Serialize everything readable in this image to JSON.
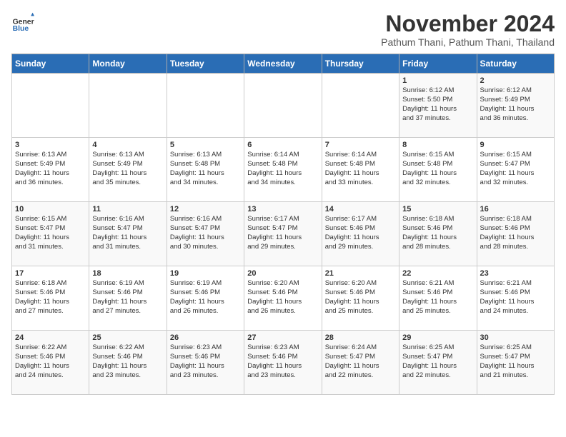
{
  "header": {
    "logo_general": "General",
    "logo_blue": "Blue",
    "month_title": "November 2024",
    "location": "Pathum Thani, Pathum Thani, Thailand"
  },
  "days_of_week": [
    "Sunday",
    "Monday",
    "Tuesday",
    "Wednesday",
    "Thursday",
    "Friday",
    "Saturday"
  ],
  "weeks": [
    [
      {
        "day": "",
        "info": ""
      },
      {
        "day": "",
        "info": ""
      },
      {
        "day": "",
        "info": ""
      },
      {
        "day": "",
        "info": ""
      },
      {
        "day": "",
        "info": ""
      },
      {
        "day": "1",
        "info": "Sunrise: 6:12 AM\nSunset: 5:50 PM\nDaylight: 11 hours\nand 37 minutes."
      },
      {
        "day": "2",
        "info": "Sunrise: 6:12 AM\nSunset: 5:49 PM\nDaylight: 11 hours\nand 36 minutes."
      }
    ],
    [
      {
        "day": "3",
        "info": "Sunrise: 6:13 AM\nSunset: 5:49 PM\nDaylight: 11 hours\nand 36 minutes."
      },
      {
        "day": "4",
        "info": "Sunrise: 6:13 AM\nSunset: 5:49 PM\nDaylight: 11 hours\nand 35 minutes."
      },
      {
        "day": "5",
        "info": "Sunrise: 6:13 AM\nSunset: 5:48 PM\nDaylight: 11 hours\nand 34 minutes."
      },
      {
        "day": "6",
        "info": "Sunrise: 6:14 AM\nSunset: 5:48 PM\nDaylight: 11 hours\nand 34 minutes."
      },
      {
        "day": "7",
        "info": "Sunrise: 6:14 AM\nSunset: 5:48 PM\nDaylight: 11 hours\nand 33 minutes."
      },
      {
        "day": "8",
        "info": "Sunrise: 6:15 AM\nSunset: 5:48 PM\nDaylight: 11 hours\nand 32 minutes."
      },
      {
        "day": "9",
        "info": "Sunrise: 6:15 AM\nSunset: 5:47 PM\nDaylight: 11 hours\nand 32 minutes."
      }
    ],
    [
      {
        "day": "10",
        "info": "Sunrise: 6:15 AM\nSunset: 5:47 PM\nDaylight: 11 hours\nand 31 minutes."
      },
      {
        "day": "11",
        "info": "Sunrise: 6:16 AM\nSunset: 5:47 PM\nDaylight: 11 hours\nand 31 minutes."
      },
      {
        "day": "12",
        "info": "Sunrise: 6:16 AM\nSunset: 5:47 PM\nDaylight: 11 hours\nand 30 minutes."
      },
      {
        "day": "13",
        "info": "Sunrise: 6:17 AM\nSunset: 5:47 PM\nDaylight: 11 hours\nand 29 minutes."
      },
      {
        "day": "14",
        "info": "Sunrise: 6:17 AM\nSunset: 5:46 PM\nDaylight: 11 hours\nand 29 minutes."
      },
      {
        "day": "15",
        "info": "Sunrise: 6:18 AM\nSunset: 5:46 PM\nDaylight: 11 hours\nand 28 minutes."
      },
      {
        "day": "16",
        "info": "Sunrise: 6:18 AM\nSunset: 5:46 PM\nDaylight: 11 hours\nand 28 minutes."
      }
    ],
    [
      {
        "day": "17",
        "info": "Sunrise: 6:18 AM\nSunset: 5:46 PM\nDaylight: 11 hours\nand 27 minutes."
      },
      {
        "day": "18",
        "info": "Sunrise: 6:19 AM\nSunset: 5:46 PM\nDaylight: 11 hours\nand 27 minutes."
      },
      {
        "day": "19",
        "info": "Sunrise: 6:19 AM\nSunset: 5:46 PM\nDaylight: 11 hours\nand 26 minutes."
      },
      {
        "day": "20",
        "info": "Sunrise: 6:20 AM\nSunset: 5:46 PM\nDaylight: 11 hours\nand 26 minutes."
      },
      {
        "day": "21",
        "info": "Sunrise: 6:20 AM\nSunset: 5:46 PM\nDaylight: 11 hours\nand 25 minutes."
      },
      {
        "day": "22",
        "info": "Sunrise: 6:21 AM\nSunset: 5:46 PM\nDaylight: 11 hours\nand 25 minutes."
      },
      {
        "day": "23",
        "info": "Sunrise: 6:21 AM\nSunset: 5:46 PM\nDaylight: 11 hours\nand 24 minutes."
      }
    ],
    [
      {
        "day": "24",
        "info": "Sunrise: 6:22 AM\nSunset: 5:46 PM\nDaylight: 11 hours\nand 24 minutes."
      },
      {
        "day": "25",
        "info": "Sunrise: 6:22 AM\nSunset: 5:46 PM\nDaylight: 11 hours\nand 23 minutes."
      },
      {
        "day": "26",
        "info": "Sunrise: 6:23 AM\nSunset: 5:46 PM\nDaylight: 11 hours\nand 23 minutes."
      },
      {
        "day": "27",
        "info": "Sunrise: 6:23 AM\nSunset: 5:46 PM\nDaylight: 11 hours\nand 23 minutes."
      },
      {
        "day": "28",
        "info": "Sunrise: 6:24 AM\nSunset: 5:47 PM\nDaylight: 11 hours\nand 22 minutes."
      },
      {
        "day": "29",
        "info": "Sunrise: 6:25 AM\nSunset: 5:47 PM\nDaylight: 11 hours\nand 22 minutes."
      },
      {
        "day": "30",
        "info": "Sunrise: 6:25 AM\nSunset: 5:47 PM\nDaylight: 11 hours\nand 21 minutes."
      }
    ]
  ]
}
